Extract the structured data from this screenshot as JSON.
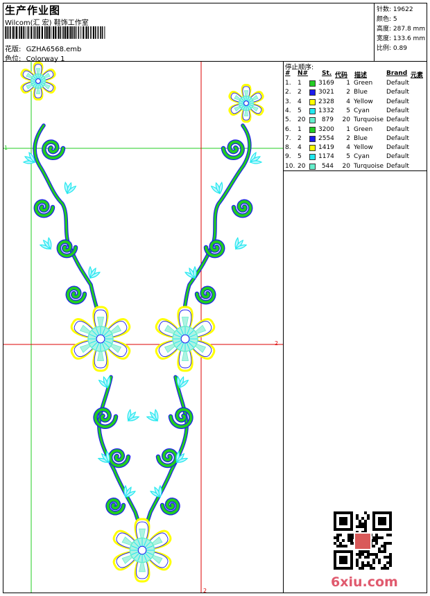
{
  "header": {
    "title": "生产作业图",
    "subtitle": "Wilcom(汇 宏) 鞋饰工作室",
    "design_label": "花版:",
    "design_value": "GZHA6568.emb",
    "colorway_label": "色位:",
    "colorway_value": "Colorway 1"
  },
  "stats": [
    {
      "label": "针数:",
      "value": "19622"
    },
    {
      "label": "颜色:",
      "value": "5"
    },
    {
      "label": "高度:",
      "value": "287.8 mm"
    },
    {
      "label": "宽度:",
      "value": "133.6 mm"
    },
    {
      "label": "比例:",
      "value": "0.89"
    }
  ],
  "stops": {
    "title": "停止顺序:",
    "headers": [
      "#",
      "N#",
      "St.",
      "代码",
      "描述",
      "Brand",
      "元素"
    ],
    "rows": [
      {
        "n": "1.",
        "nn": "1",
        "color": "#22cc22",
        "st": "3169",
        "code": "1",
        "desc": "Green",
        "brand": "Default"
      },
      {
        "n": "2.",
        "nn": "2",
        "color": "#1a1aee",
        "st": "3021",
        "code": "2",
        "desc": "Blue",
        "brand": "Default"
      },
      {
        "n": "3.",
        "nn": "4",
        "color": "#ffff00",
        "st": "2328",
        "code": "4",
        "desc": "Yellow",
        "brand": "Default"
      },
      {
        "n": "4.",
        "nn": "5",
        "color": "#22e8ee",
        "st": "1332",
        "code": "5",
        "desc": "Cyan",
        "brand": "Default"
      },
      {
        "n": "5.",
        "nn": "20",
        "color": "#66eecc",
        "st": "879",
        "code": "20",
        "desc": "Turquoise",
        "brand": "Default"
      },
      {
        "n": "6.",
        "nn": "1",
        "color": "#22cc22",
        "st": "3200",
        "code": "1",
        "desc": "Green",
        "brand": "Default"
      },
      {
        "n": "7.",
        "nn": "2",
        "color": "#1a1aee",
        "st": "2554",
        "code": "2",
        "desc": "Blue",
        "brand": "Default"
      },
      {
        "n": "8.",
        "nn": "4",
        "color": "#ffff00",
        "st": "1419",
        "code": "4",
        "desc": "Yellow",
        "brand": "Default"
      },
      {
        "n": "9.",
        "nn": "5",
        "color": "#22e8ee",
        "st": "1174",
        "code": "5",
        "desc": "Cyan",
        "brand": "Default"
      },
      {
        "n": "10.",
        "nn": "20",
        "color": "#66eecc",
        "st": "544",
        "code": "20",
        "desc": "Turquoise",
        "brand": "Default"
      }
    ]
  },
  "guides": {
    "h1": "1",
    "v1": "1",
    "h2": "2",
    "v2": "2"
  },
  "watermark": "6xiu.com",
  "colors": {
    "guide_green": "#22cc22",
    "guide_red": "#dd0000",
    "thread_green": "#22cc22",
    "thread_blue": "#1a1aee",
    "thread_yellow": "#ffff00",
    "thread_cyan": "#22e8ee",
    "thread_turquoise": "#66eecc"
  }
}
